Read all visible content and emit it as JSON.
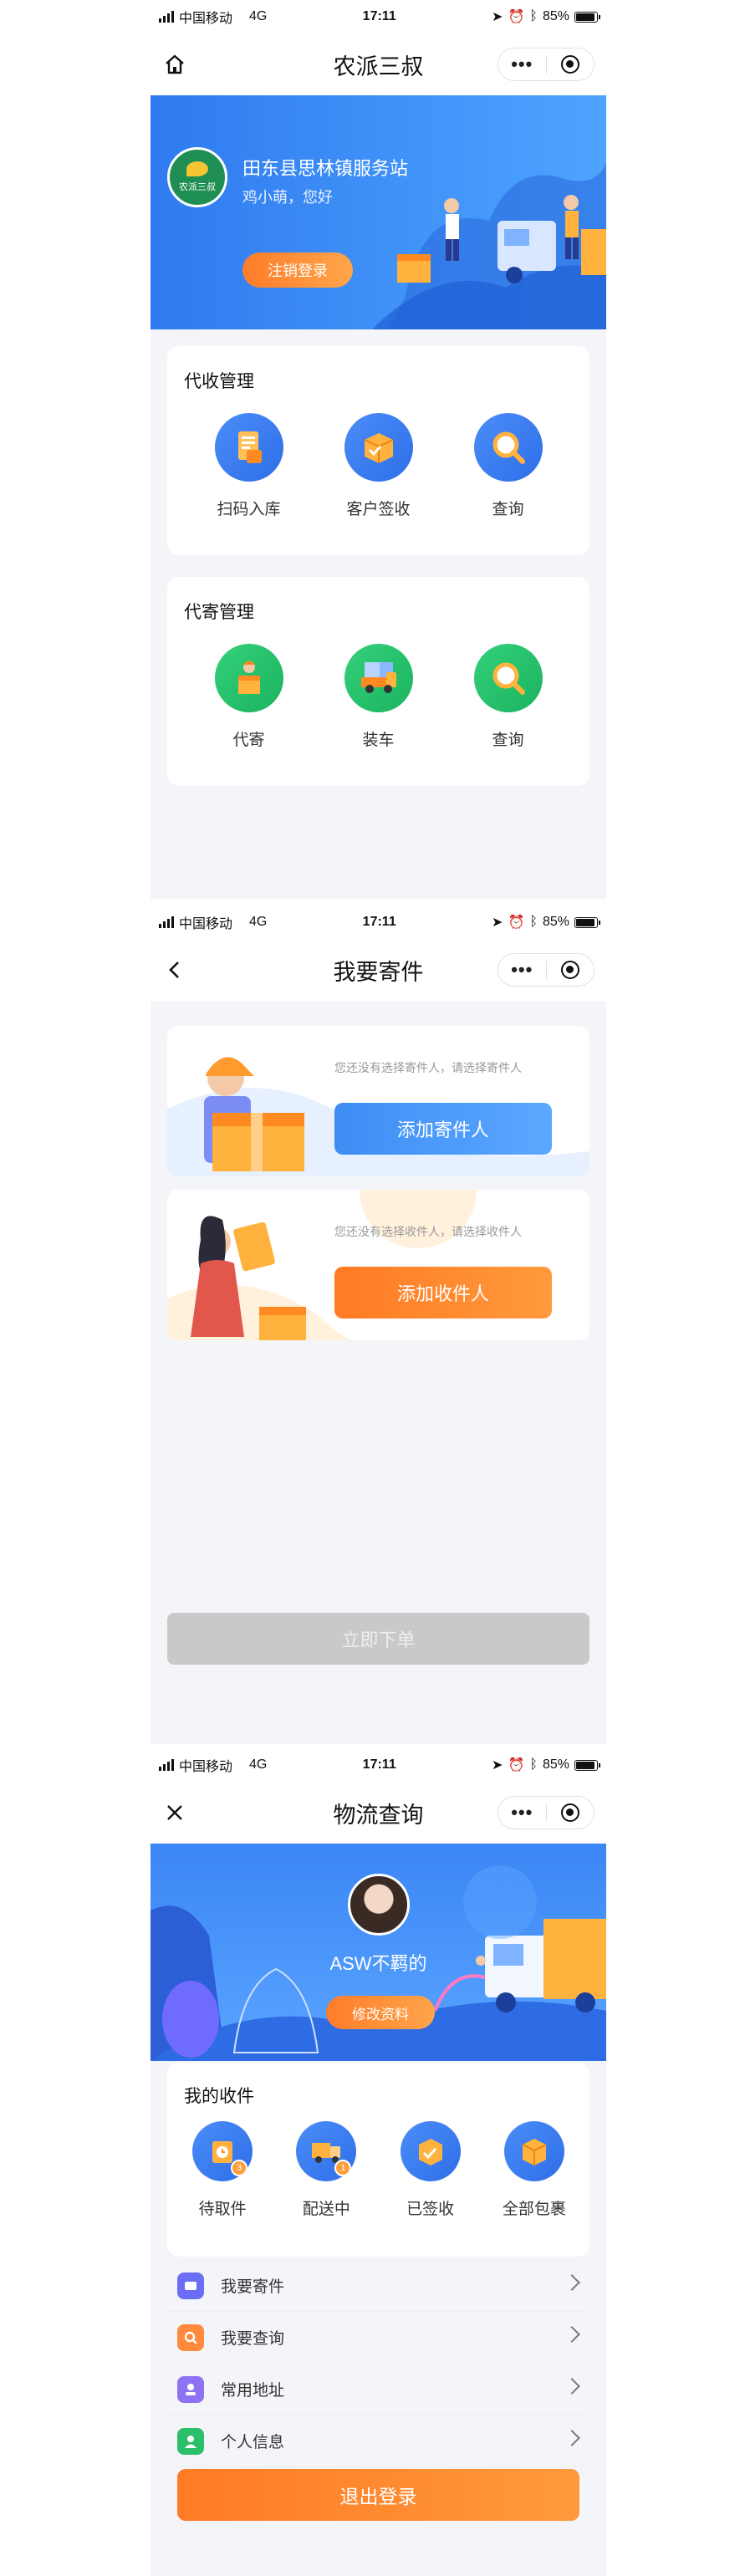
{
  "status": {
    "carrier": "中国移动",
    "network": "4G",
    "time": "17:11",
    "battery_text": "85%",
    "battery_level": 0.85
  },
  "page1": {
    "nav_title": "农派三叔",
    "logo_text": "农派三叔",
    "station_name": "田东县思林镇服务站",
    "greeting": "鸡小萌，您好",
    "logout_label": "注销登录",
    "collect": {
      "title": "代收管理",
      "items": [
        {
          "label": "扫码入库",
          "icon": "scan-document-icon",
          "color": "#3b7cf4"
        },
        {
          "label": "客户签收",
          "icon": "package-signed-icon",
          "color": "#3b7cf4"
        },
        {
          "label": "查询",
          "icon": "magnifier-icon",
          "color": "#3b7cf4"
        }
      ]
    },
    "send": {
      "title": "代寄管理",
      "items": [
        {
          "label": "代寄",
          "icon": "courier-package-icon",
          "color": "#22c06a"
        },
        {
          "label": "装车",
          "icon": "truck-loading-icon",
          "color": "#22c06a"
        },
        {
          "label": "查询",
          "icon": "magnifier-icon",
          "color": "#22c06a"
        }
      ]
    }
  },
  "page2": {
    "nav_title": "我要寄件",
    "sender_hint": "您还没有选择寄件人，请选择寄件人",
    "sender_button": "添加寄件人",
    "receiver_hint": "您还没有选择收件人，请选择收件人",
    "receiver_button": "添加收件人",
    "submit_label": "立即下单"
  },
  "page3": {
    "nav_title": "物流查询",
    "user_name": "ASW不羁的",
    "edit_label": "修改资料",
    "parcels_title": "我的收件",
    "parcels": [
      {
        "label": "待取件",
        "icon": "pickup-package-icon",
        "badge": "3"
      },
      {
        "label": "配送中",
        "icon": "delivery-truck-icon",
        "badge": "1"
      },
      {
        "label": "已签收",
        "icon": "signed-package-icon",
        "badge": ""
      },
      {
        "label": "全部包裹",
        "icon": "all-packages-icon",
        "badge": ""
      }
    ],
    "menu": [
      {
        "label": "我要寄件",
        "icon": "send-icon",
        "color": "#6b6ef5"
      },
      {
        "label": "我要查询",
        "icon": "search-icon",
        "color": "#ff8a3d"
      },
      {
        "label": "常用地址",
        "icon": "address-icon",
        "color": "#8e72f2"
      },
      {
        "label": "个人信息",
        "icon": "profile-icon",
        "color": "#2bbf6a"
      }
    ],
    "logout_label": "退出登录"
  }
}
